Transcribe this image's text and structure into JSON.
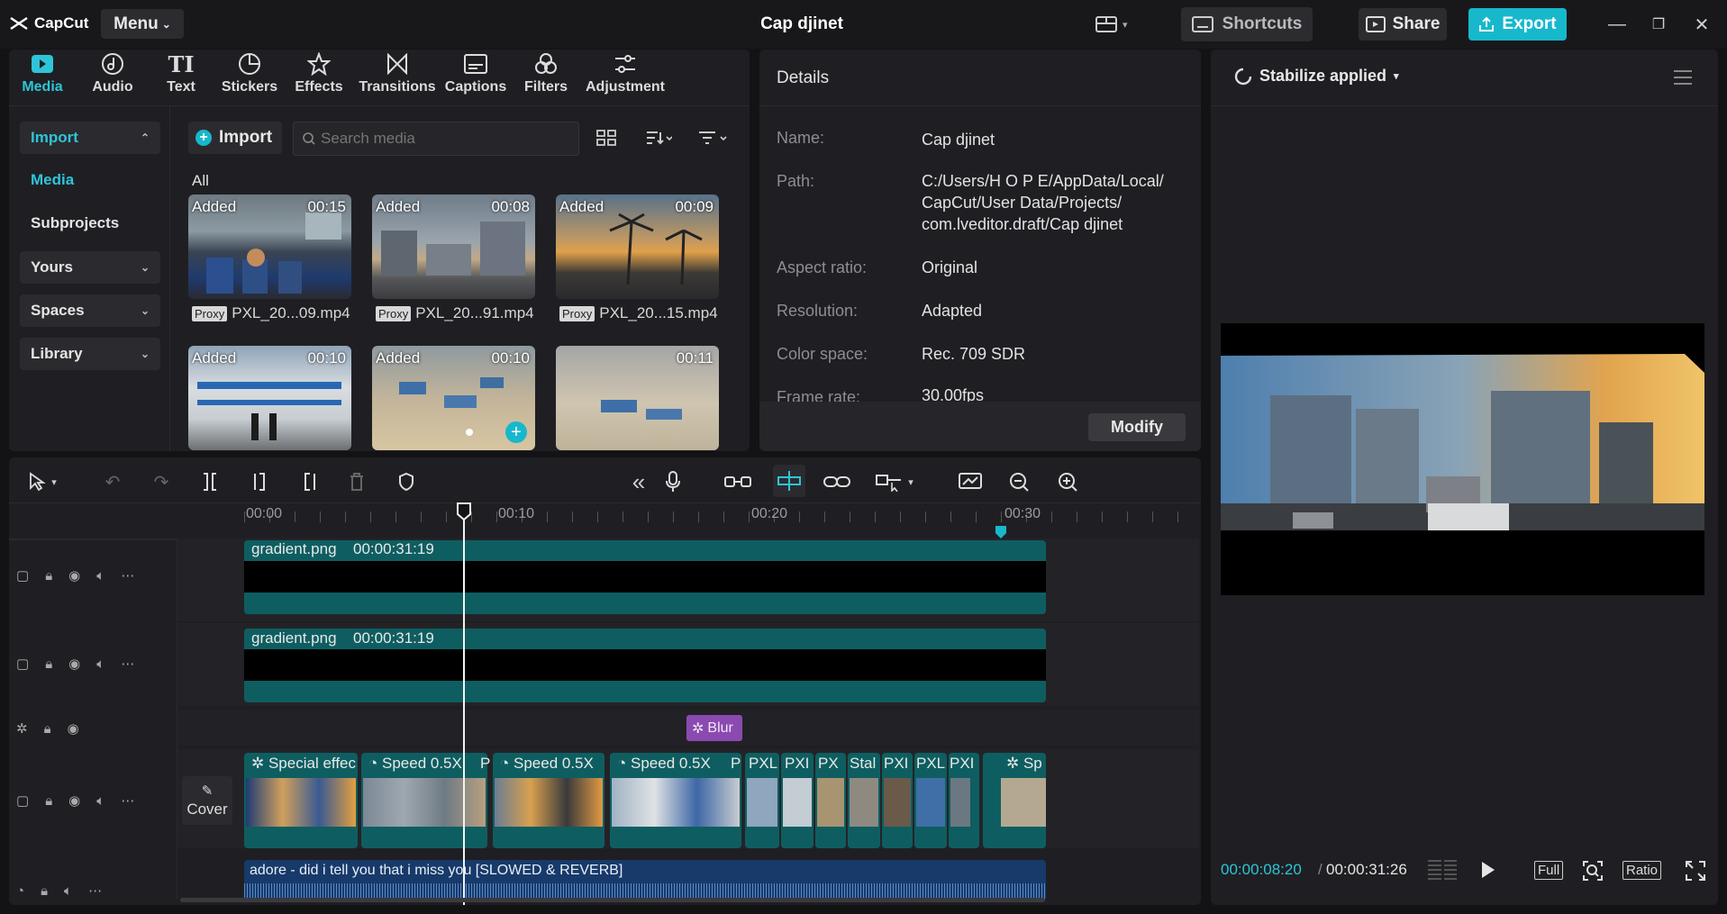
{
  "app": {
    "logo_text": "CapCut",
    "menu_label": "Menu",
    "project_title": "Cap djinet"
  },
  "titlebar": {
    "shortcuts_label": "Shortcuts",
    "share_label": "Share",
    "export_label": "Export"
  },
  "tabs": [
    {
      "label": "Media",
      "icon": "media-icon"
    },
    {
      "label": "Audio",
      "icon": "audio-icon"
    },
    {
      "label": "Text",
      "icon": "text-icon"
    },
    {
      "label": "Stickers",
      "icon": "stickers-icon"
    },
    {
      "label": "Effects",
      "icon": "effects-icon"
    },
    {
      "label": "Transitions",
      "icon": "transitions-icon"
    },
    {
      "label": "Captions",
      "icon": "captions-icon"
    },
    {
      "label": "Filters",
      "icon": "filters-icon"
    },
    {
      "label": "Adjustment",
      "icon": "adjustment-icon"
    }
  ],
  "sidebar": {
    "import_label": "Import",
    "media_label": "Media",
    "subprojects_label": "Subprojects",
    "yours_label": "Yours",
    "spaces_label": "Spaces",
    "library_label": "Library"
  },
  "media": {
    "import_button": "Import",
    "search_placeholder": "Search media",
    "all_label": "All",
    "items": [
      {
        "added": "Added",
        "duration": "00:15",
        "proxy": "Proxy",
        "name": "PXL_20...09.mp4"
      },
      {
        "added": "Added",
        "duration": "00:08",
        "proxy": "Proxy",
        "name": "PXL_20...91.mp4"
      },
      {
        "added": "Added",
        "duration": "00:09",
        "proxy": "Proxy",
        "name": "PXL_20...15.mp4"
      },
      {
        "added": "Added",
        "duration": "00:10"
      },
      {
        "added": "Added",
        "duration": "00:10"
      },
      {
        "duration": "00:11"
      }
    ]
  },
  "details": {
    "header": "Details",
    "name_key": "Name:",
    "name_val": "Cap djinet",
    "path_key": "Path:",
    "path_val_1": "C:/Users/H O P E/AppData/Local/",
    "path_val_2": "CapCut/User Data/Projects/",
    "path_val_3": "com.lveditor.draft/Cap djinet",
    "aspect_key": "Aspect ratio:",
    "aspect_val": "Original",
    "resolution_key": "Resolution:",
    "resolution_val": "Adapted",
    "color_key": "Color space:",
    "color_val": "Rec. 709 SDR",
    "frame_key": "Frame rate:",
    "frame_val": "30.00fps",
    "modify_label": "Modify"
  },
  "player": {
    "status": "Stabilize applied",
    "current_time": "00:00:08:20",
    "separator": "/",
    "total_time": "00:00:31:26",
    "full_label": "Full",
    "ratio_label": "Ratio"
  },
  "timeline": {
    "ruler": [
      "00:00",
      "00:10",
      "00:20",
      "00:30"
    ],
    "track1_name": "gradient.png",
    "track1_dur": "00:00:31:19",
    "track2_name": "gradient.png",
    "track2_dur": "00:00:31:19",
    "effect_clip": "Blur",
    "cover_label": "Cover",
    "main_clips": [
      "Special effec",
      "Speed 0.5X",
      "P",
      "Speed 0.5X",
      "Speed 0.5X",
      "P",
      "PXL",
      "PXI",
      "PX",
      "Stal",
      "PXI",
      "PXL",
      "PXI",
      "Sp"
    ],
    "audio_clip": "adore - did i tell you that i miss you [SLOWED & REVERB]"
  },
  "colors": {
    "accent": "#17b8cc",
    "track_teal": "#0e5e61",
    "effect_purple": "#8a4ab0"
  }
}
